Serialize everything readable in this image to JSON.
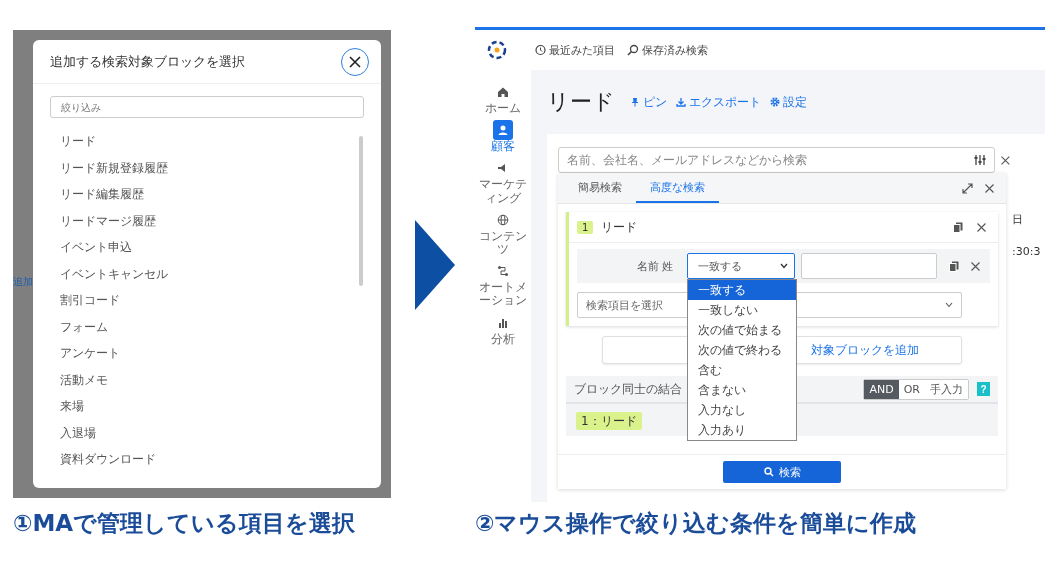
{
  "left_panel": {
    "background_text": "追加",
    "modal": {
      "title": "追加する検索対象ブロックを選択",
      "filter": {
        "placeholder": "絞り込み"
      },
      "items": [
        "リード",
        "リード新規登録履歴",
        "リード編集履歴",
        "リードマージ履歴",
        "イベント申込",
        "イベントキャンセル",
        "割引コード",
        "フォーム",
        "アンケート",
        "活動メモ",
        "来場",
        "入退場",
        "資料ダウンロード"
      ]
    }
  },
  "right_panel": {
    "header_links": [
      "最近みた項目",
      "保存済み検索"
    ],
    "sidebar": [
      {
        "label": "ホーム",
        "selected": false
      },
      {
        "label": "顧客",
        "selected": true
      },
      {
        "label": "マーケティング",
        "selected": false
      },
      {
        "label": "コンテンツ",
        "selected": false
      },
      {
        "label": "オートメーション",
        "selected": false
      },
      {
        "label": "分析",
        "selected": false
      }
    ],
    "page_title": "リード",
    "actions": [
      "ピン",
      "エクスポート",
      "設定"
    ],
    "search": {
      "placeholder": "名前、会社名、メールアドレスなどから検索"
    },
    "tabs": [
      {
        "label": "簡易検索",
        "selected": false
      },
      {
        "label": "高度な検索",
        "selected": true
      }
    ],
    "block": {
      "number": "1",
      "title": "リード",
      "condition": {
        "field_label": "名前 姓",
        "operator": "一致する"
      },
      "field_select": {
        "placeholder": "検索項目を選択"
      }
    },
    "operator_options": [
      {
        "label": "一致する",
        "selected": true
      },
      {
        "label": "一致しない",
        "selected": false
      },
      {
        "label": "次の値で始まる",
        "selected": false
      },
      {
        "label": "次の値で終わる",
        "selected": false
      },
      {
        "label": "含む",
        "selected": false
      },
      {
        "label": "含まない",
        "selected": false
      },
      {
        "label": "入力なし",
        "selected": false
      },
      {
        "label": "入力あり",
        "selected": false
      }
    ],
    "add_block_button": "対象ブロックを追加",
    "combine": {
      "label": "ブロック同士の結合",
      "modes": [
        {
          "label": "AND",
          "selected": true
        },
        {
          "label": "OR",
          "selected": false
        },
        {
          "label": "手入力",
          "selected": false
        }
      ],
      "help": "?"
    },
    "chips": [
      "1：リード"
    ],
    "search_button": "検索",
    "background_texts": [
      "日",
      ":30:3"
    ]
  },
  "captions": [
    "①MAで管理している項目を選択",
    "②マウス操作で絞り込む条件を簡単に作成"
  ]
}
